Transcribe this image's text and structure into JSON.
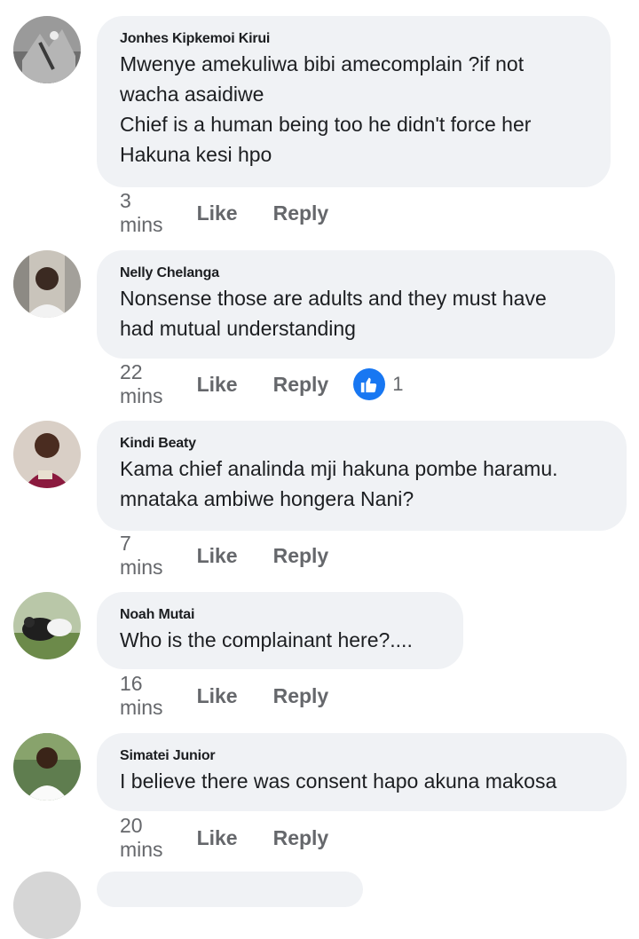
{
  "ui": {
    "like_label": "Like",
    "reply_label": "Reply"
  },
  "comments": [
    {
      "author": "Jonhes Kipkemoi Kirui",
      "text": "Mwenye amekuliwa bibi amecomplain ?if not\nwacha asaidiwe\nChief is a human being too  he didn't force her\nHakuna kesi hpo",
      "time": "3 mins"
    },
    {
      "author": "Nelly Chelanga",
      "text": "Nonsense those are adults and they must have\nhad mutual understanding",
      "time": "22 mins",
      "reaction_icon": "like-icon",
      "reaction_count": "1"
    },
    {
      "author": "Kindi Beaty",
      "text": "Kama chief analinda mji hakuna pombe haramu.\nmnataka ambiwe hongera Nani?",
      "time": "7 mins"
    },
    {
      "author": "Noah Mutai",
      "text": "Who is the complainant here?....",
      "time": "16 mins"
    },
    {
      "author": "Simatei Junior",
      "text": "I believe there was consent hapo akuna makosa",
      "time": "20 mins"
    }
  ],
  "colors": {
    "bubble": "#f0f2f5",
    "meta_text": "#65676b",
    "like_blue": "#1877f2"
  }
}
